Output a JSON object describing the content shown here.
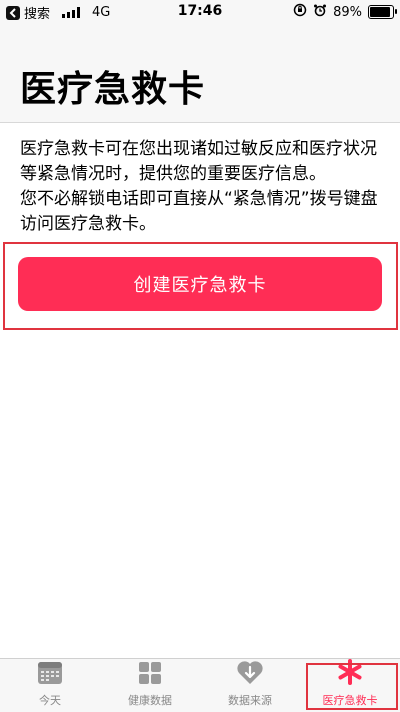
{
  "status_bar": {
    "carrier_back": "搜索",
    "network": "4G",
    "time": "17:46",
    "battery": "89%",
    "battery_level": 0.89
  },
  "header": {
    "title": "医疗急救卡"
  },
  "description": {
    "paragraph1": "医疗急救卡可在您出现诸如过敏反应和医疗状况等紧急情况时，提供您的重要医疗信息。",
    "paragraph2": "您不必解锁电话即可直接从“紧急情况”拨号键盘访问医疗急救卡。"
  },
  "cta": {
    "label": "创建医疗急救卡"
  },
  "tabs": [
    {
      "label": "今天",
      "icon": "calendar-icon"
    },
    {
      "label": "健康数据",
      "icon": "grid-icon"
    },
    {
      "label": "数据来源",
      "icon": "heart-download-icon"
    },
    {
      "label": "医疗急救卡",
      "icon": "medical-asterisk-icon",
      "active": true
    }
  ],
  "colors": {
    "accent": "#ff2d55",
    "highlight": "#e0343f",
    "inactive": "#888888"
  }
}
